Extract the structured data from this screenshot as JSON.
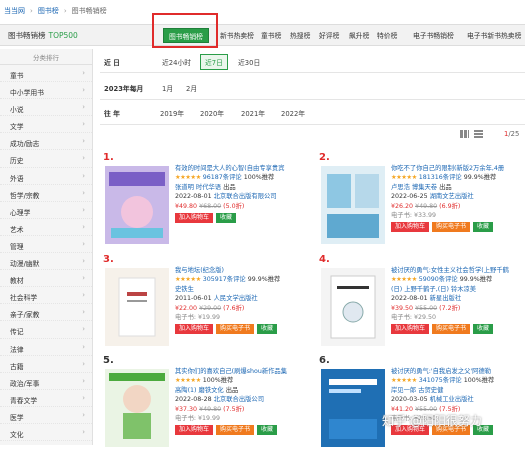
{
  "breadcrumb": {
    "home": "当当网",
    "sep": "›",
    "section": "图书榜",
    "current": "图书畅销榜"
  },
  "navbar": {
    "brand": "图书畅销榜",
    "brand_suffix": "TOP500",
    "tabs": [
      "图书畅销榜",
      "新书热卖榜",
      "童书榜",
      "热搜榜",
      "好评榜",
      "飙升榜",
      "特价榜",
      "电子书畅销榜",
      "电子书新书热卖榜"
    ]
  },
  "sidebar": {
    "title": "分类排行",
    "items": [
      "童书",
      "中小学用书",
      "小说",
      "文学",
      "成功/励志",
      "历史",
      "外语",
      "哲学/宗教",
      "心理学",
      "艺术",
      "管理",
      "动漫/幽默",
      "教材",
      "社会科学",
      "亲子/家教",
      "传记",
      "法律",
      "古籍",
      "政治/军事",
      "青春文学",
      "医学",
      "文化"
    ]
  },
  "filters": {
    "recent": {
      "label": "近 日",
      "options": [
        "近24小时",
        "近7日",
        "近30日"
      ]
    },
    "month": {
      "label": "2023年每月",
      "options": [
        "1月",
        "2月"
      ]
    },
    "year": {
      "label": "往 年",
      "options": [
        "2019年",
        "2020年",
        "2021年",
        "2022年"
      ]
    }
  },
  "pager": {
    "current": "1",
    "total": "/25"
  },
  "products": [
    {
      "rank": "1.",
      "title": "有效的时间是大人的心智(自由专享贵宾",
      "rating": "96187条评论",
      "recommend": "100%推荐",
      "author": "张道明",
      "publisher": "时代华语",
      "publish_tag": "出品",
      "date": "2022-08-01",
      "house": "北京联合出版有限公司",
      "price": "¥49.80",
      "orig": "¥68.00",
      "discount": "(5.0折)",
      "ebook": "",
      "cart": "加入购物车",
      "ebook_btn": "",
      "fav": "收藏"
    },
    {
      "rank": "2.",
      "title": "你吃不了你自己的限制(新版2万余年,4册",
      "rating": "181316条评论",
      "recommend": "99.9%推荐",
      "author": "卢思浩",
      "publisher": "博集天卷",
      "publish_tag": "出品",
      "date": "2022-06-25",
      "house": "湖南文艺出版社",
      "price": "¥26.20",
      "orig": "¥49.80",
      "discount": "(6.9折)",
      "ebook": "电子书: ¥33.99",
      "cart": "加入购物车",
      "ebook_btn": "购买电子书",
      "fav": "收藏"
    },
    {
      "rank": "3.",
      "title": "我与地坛(纪念版)",
      "rating": "305917条评论",
      "recommend": "99.9%推荐",
      "author": "史铁生",
      "publisher": "",
      "publish_tag": "",
      "date": "2011-06-01",
      "house": "人民文学出版社",
      "price": "¥22.00",
      "orig": "¥29.00",
      "discount": "(7.6折)",
      "ebook": "电子书: ¥19.99",
      "cart": "加入购物车",
      "ebook_btn": "购买电子书",
      "fav": "收藏"
    },
    {
      "rank": "4.",
      "title": "被讨厌的勇气:女性主义社会哲学(上野千鹤",
      "rating": "59090条评论",
      "recommend": "99.9%推荐",
      "author": "(日) 上野千鹤子,(日) 铃木凉美",
      "publisher": "",
      "publish_tag": "",
      "date": "2022-08-01",
      "house": "新星出版社",
      "price": "¥39.50",
      "orig": "¥55.00",
      "discount": "(7.2折)",
      "ebook": "电子书: ¥29.50",
      "cart": "加入购物车",
      "ebook_btn": "购买电子书",
      "fav": "收藏"
    },
    {
      "rank": "5.",
      "title": "其实你们的喜欢自己(刷爆shou新作品集",
      "rating": "",
      "recommend": "100%推荐",
      "author": "高陶(1)",
      "publisher": "磨铁文化",
      "publish_tag": "出品",
      "date": "2022-08-28",
      "house": "北京联合出版公司",
      "price": "¥37.30",
      "orig": "¥49.80",
      "discount": "(7.5折)",
      "ebook": "电子书: ¥19.99",
      "cart": "加入购物车",
      "ebook_btn": "购买电子书",
      "fav": "收藏"
    },
    {
      "rank": "6.",
      "title": "被讨厌的勇气:'自我启发之父'阿德勒",
      "rating": "341075条评论",
      "recommend": "100%推荐",
      "author": "岸见一郎",
      "publisher": "古贺史健",
      "publish_tag": "",
      "date": "2020-03-05",
      "house": "机械工业出版社",
      "price": "¥41.20",
      "orig": "¥55.00",
      "discount": "(7.5折)",
      "ebook": "电子书: ¥29.50",
      "cart": "加入购物车",
      "ebook_btn": "购买电子书",
      "fav": "收藏"
    }
  ],
  "watermark": "知乎 @阳阳很努力",
  "colors": {
    "accent": "#2a9d48",
    "price": "#e02b2b",
    "link": "#1a66b3",
    "highlight_box": "#e02b2b"
  }
}
